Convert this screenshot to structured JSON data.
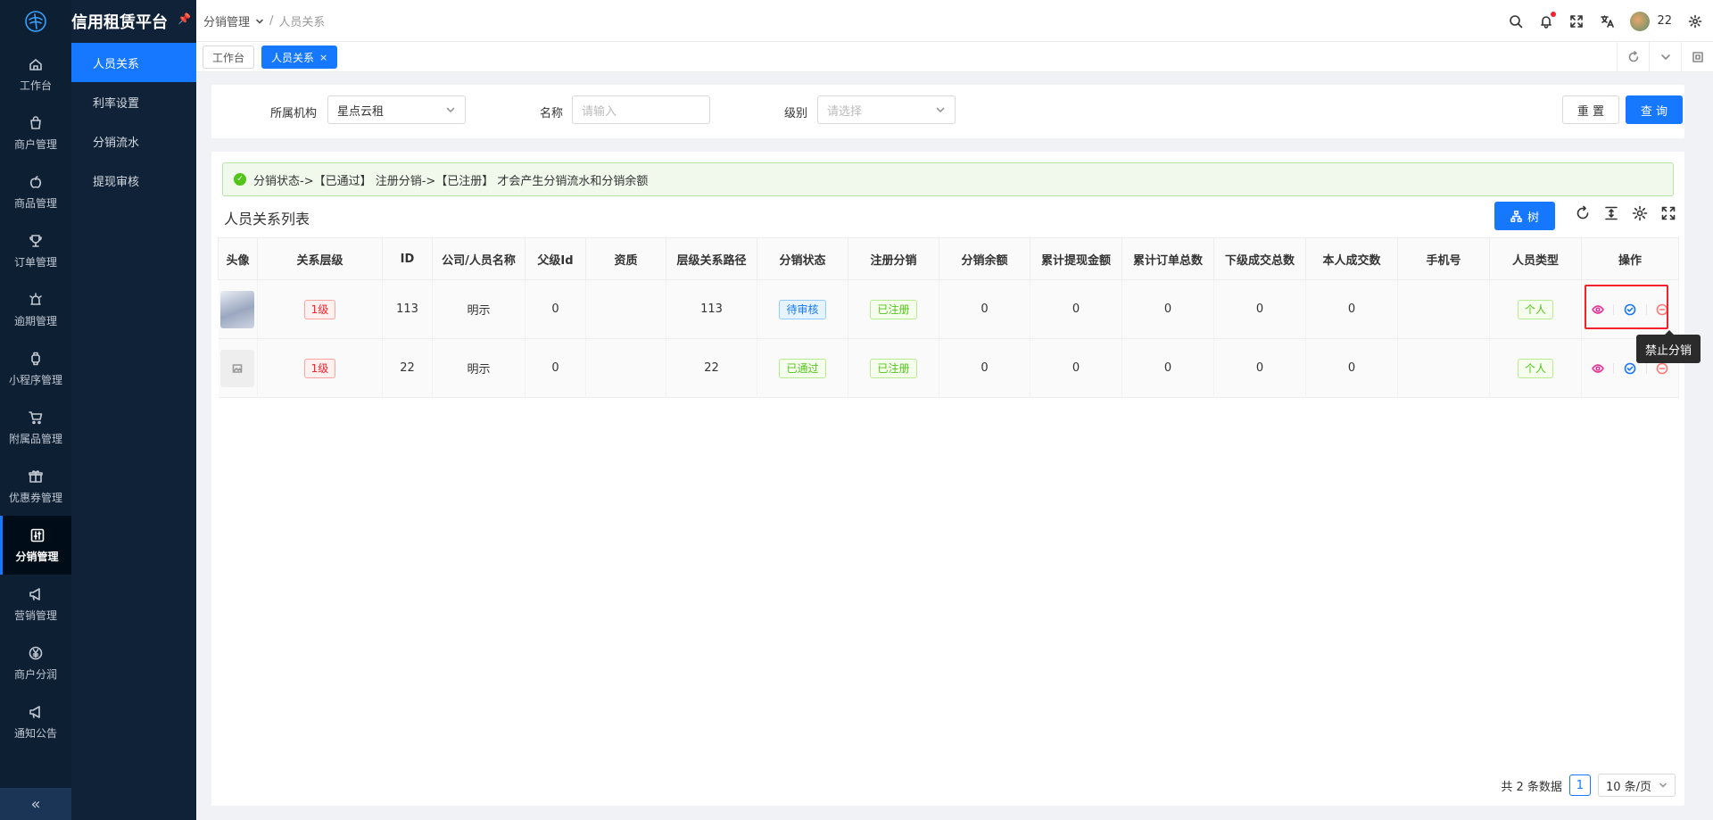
{
  "app": {
    "title": "信用租赁平台"
  },
  "rail": {
    "items": [
      {
        "label": "工作台",
        "icon": "home-icon"
      },
      {
        "label": "商户管理",
        "icon": "shop-icon"
      },
      {
        "label": "商品管理",
        "icon": "apple-icon"
      },
      {
        "label": "订单管理",
        "icon": "trophy-icon"
      },
      {
        "label": "逾期管理",
        "icon": "alarm-icon"
      },
      {
        "label": "小程序管理",
        "icon": "watch-icon"
      },
      {
        "label": "附属品管理",
        "icon": "cart-icon"
      },
      {
        "label": "优惠券管理",
        "icon": "gift-icon"
      },
      {
        "label": "分销管理",
        "icon": "sliders-icon"
      },
      {
        "label": "营销管理",
        "icon": "megaphone-icon"
      },
      {
        "label": "商户分润",
        "icon": "yen-icon"
      },
      {
        "label": "通知公告",
        "icon": "megaphone-icon"
      }
    ],
    "active_index": 8
  },
  "submenu": {
    "items": [
      "人员关系",
      "利率设置",
      "分销流水",
      "提现审核"
    ],
    "active_index": 0
  },
  "header": {
    "breadcrumb_parent": "分销管理",
    "breadcrumb_sep": "/",
    "breadcrumb_current": "人员关系",
    "user": "22"
  },
  "tabs": [
    {
      "label": "工作台",
      "active": false
    },
    {
      "label": "人员关系",
      "active": true,
      "close": "×"
    }
  ],
  "filter": {
    "org_label": "所属机构",
    "org_value": "星点云租",
    "name_label": "名称",
    "name_placeholder": "请输入",
    "level_label": "级别",
    "level_placeholder": "请选择",
    "reset_label": "重 置",
    "search_label": "查 询"
  },
  "alert": {
    "text": "分销状态->【已通过】 注册分销->【已注册】 才会产生分销流水和分销余额"
  },
  "list": {
    "title": "人员关系列表",
    "tree_label": "树"
  },
  "table": {
    "columns": [
      "头像",
      "关系层级",
      "ID",
      "公司/人员名称",
      "父级Id",
      "资质",
      "层级关系路径",
      "分销状态",
      "注册分销",
      "分销余额",
      "累计提现金额",
      "累计订单总数",
      "下级成交总数",
      "本人成交数",
      "手机号",
      "人员类型",
      "操作"
    ],
    "rows": [
      {
        "level": "1级",
        "id": "113",
        "name": "明示",
        "parent_id": "0",
        "qual": "",
        "path": "113",
        "status": "待审核",
        "status_color": "blue",
        "reg": "已注册",
        "balance": "0",
        "withdraw": "0",
        "orders": "0",
        "sub_deals": "0",
        "self_deals": "0",
        "phone": "",
        "type": "个人",
        "has_avatar": true
      },
      {
        "level": "1级",
        "id": "22",
        "name": "明示",
        "parent_id": "0",
        "qual": "",
        "path": "22",
        "status": "已通过",
        "status_color": "green",
        "reg": "已注册",
        "balance": "0",
        "withdraw": "0",
        "orders": "0",
        "sub_deals": "0",
        "self_deals": "0",
        "phone": "",
        "type": "个人",
        "has_avatar": false
      }
    ]
  },
  "tooltip": {
    "text": "禁止分销"
  },
  "pagination": {
    "total_text": "共 2 条数据",
    "current_page": "1",
    "page_size": "10 条/页"
  },
  "colors": {
    "primary": "#1677ff",
    "rail_bg": "#0d1f33",
    "danger": "#f5222d",
    "success": "#52c41a"
  }
}
